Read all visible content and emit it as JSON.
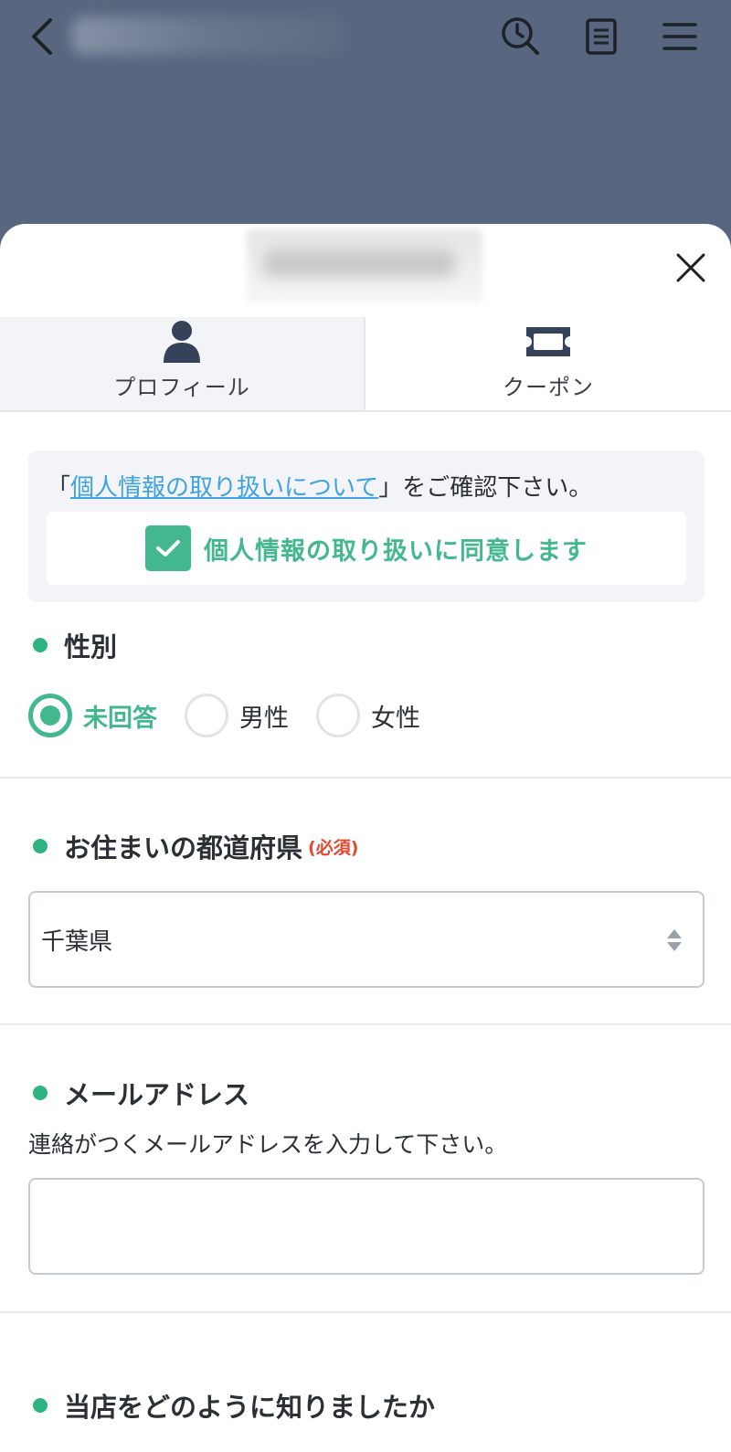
{
  "tabs": [
    {
      "label": "プロフィール",
      "icon": "person-icon"
    },
    {
      "label": "クーポン",
      "icon": "ticket-icon"
    }
  ],
  "consent": {
    "open_bracket": "「",
    "link_text": "個人情報の取り扱いについて",
    "suffix": "」をご確認下さい。",
    "agree_label": "個人情報の取り扱いに同意します",
    "agreed": true
  },
  "gender": {
    "label": "性別",
    "options": [
      "未回答",
      "男性",
      "女性"
    ],
    "selected": "未回答"
  },
  "prefecture": {
    "label": "お住まいの都道府県",
    "required": "(必須)",
    "value": "千葉県"
  },
  "email": {
    "label": "メールアドレス",
    "hint": "連絡がつくメールアドレスを入力して下さい。",
    "value": ""
  },
  "referral": {
    "label": "当店をどのように知りましたか"
  },
  "colors": {
    "accent": "#43b88f",
    "link": "#3ea2e5",
    "required": "#e4482f",
    "header": "#58667f"
  }
}
